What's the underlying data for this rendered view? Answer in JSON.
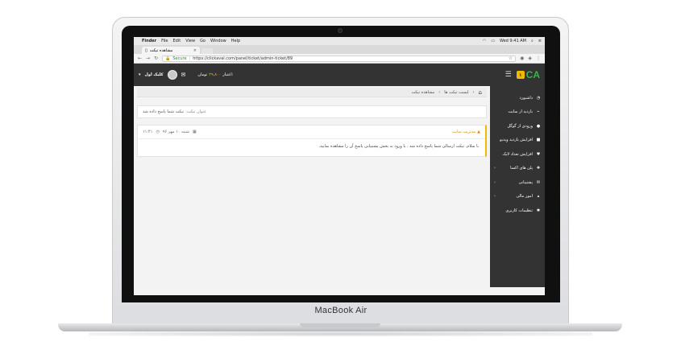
{
  "device": {
    "brand": "MacBook Air"
  },
  "menubar": {
    "apple": "",
    "items": [
      "Finder",
      "File",
      "Edit",
      "View",
      "Go",
      "Window",
      "Help"
    ],
    "clock": "Wed 9:41 AM"
  },
  "browser": {
    "tab_title": "مشاهده تیکت",
    "tab_close": "×",
    "secure": "Secure",
    "url": "https://clickaval.com/panel/ticket/admin-ticket/89"
  },
  "header": {
    "user_name": "کلیک اول",
    "credit_label": "اعتبار:",
    "credit_amount": "۲۹,۸۰۰",
    "credit_unit": "تومان",
    "logo_text": "CA",
    "logo_badge": "۱"
  },
  "breadcrumb": {
    "items": [
      "لیست تیکت ها",
      "مشاهده تیکت"
    ],
    "separator": "‹"
  },
  "ticket": {
    "subject_label": "عنوان تیکت:",
    "subject_value": "تیکت شما پاسخ داده شد",
    "sender": "مدیریت سایت",
    "date": "شنبه ۱۰ مهر ۹۶",
    "time": "۱۱:۴۱",
    "body": "با سلام. تیکت ارسالی شما پاسخ داده شد . با ورود به بخش پشتیبانی پاسخ آن را مشاهده نمایید."
  },
  "sidebar": {
    "items": [
      {
        "label": "داشبورد",
        "icon": "dashboard-icon",
        "glyph": "◔"
      },
      {
        "label": "بازدید از سایت",
        "icon": "chart-icon",
        "glyph": "⌁"
      },
      {
        "label": "ورودی از گوگل",
        "icon": "google-icon",
        "glyph": "●"
      },
      {
        "label": "افزایش بازدید ویدیو",
        "icon": "video-icon",
        "glyph": "■"
      },
      {
        "label": "افزایش تعداد لایک",
        "icon": "heart-icon",
        "glyph": "♥"
      },
      {
        "label": "پلن های اکسا",
        "icon": "plans-icon",
        "glyph": "✚",
        "chevron": "‹"
      },
      {
        "label": "پشتیبانی",
        "icon": "support-icon",
        "glyph": "✉",
        "chevron": "‹"
      },
      {
        "label": "امور مالی",
        "icon": "finance-icon",
        "glyph": "▴",
        "chevron": "‹"
      },
      {
        "label": "تنظیمات کاربری",
        "icon": "settings-icon",
        "glyph": "✱"
      }
    ]
  }
}
